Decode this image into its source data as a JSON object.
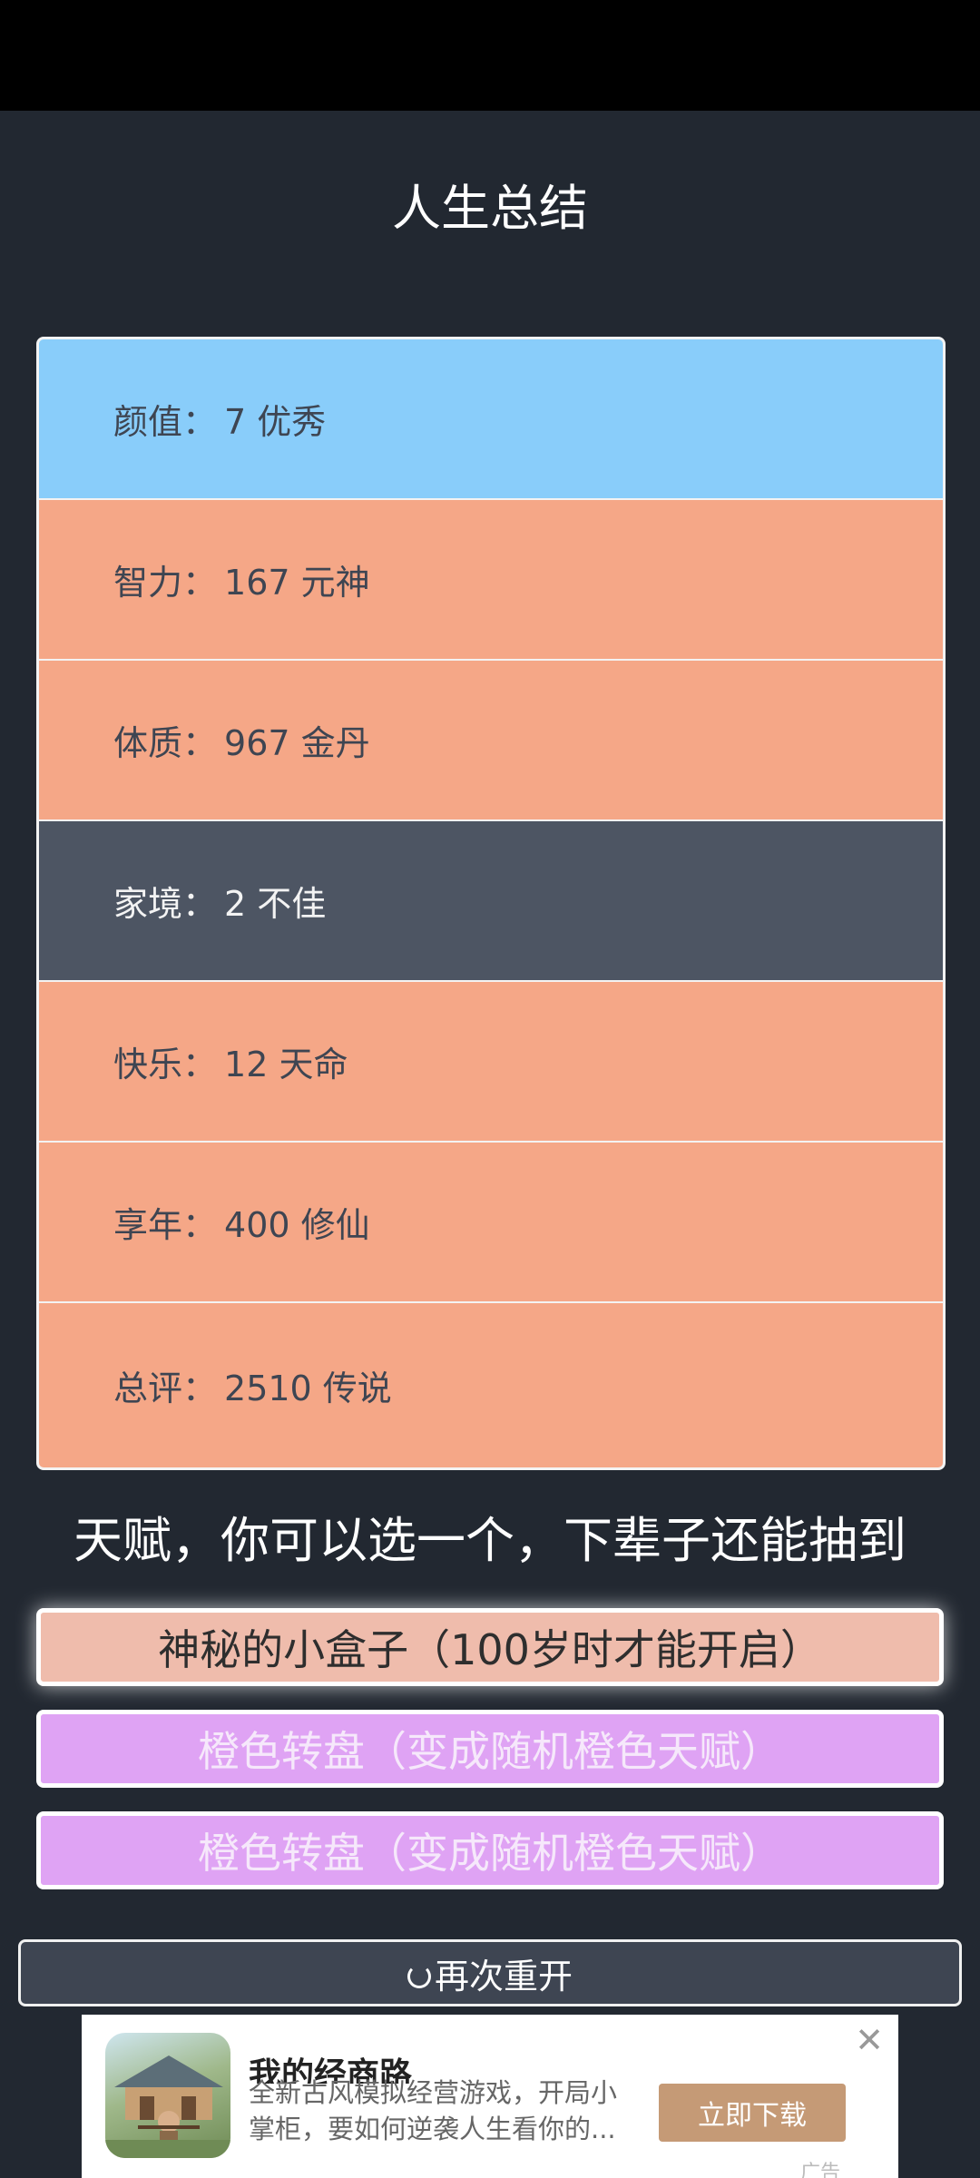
{
  "title": "人生总结",
  "stats": [
    {
      "label": "颜值：",
      "value": "7 优秀",
      "color": "#89cdfa",
      "dark": false
    },
    {
      "label": "智力：",
      "value": "167 元神",
      "color": "#f5a787",
      "dark": false
    },
    {
      "label": "体质：",
      "value": "967 金丹",
      "color": "#f5a787",
      "dark": false
    },
    {
      "label": "家境：",
      "value": "2 不佳",
      "color": "#4d5563",
      "dark": true
    },
    {
      "label": "快乐：",
      "value": "12 天命",
      "color": "#f5a787",
      "dark": false
    },
    {
      "label": "享年：",
      "value": "400 修仙",
      "color": "#f5a787",
      "dark": false
    },
    {
      "label": "总评：",
      "value": "2510 传说",
      "color": "#f5a787",
      "dark": false
    }
  ],
  "talent_heading": "天赋，你可以选一个，下辈子还能抽到",
  "talents": [
    {
      "label": "神秘的小盒子（100岁时才能开启）",
      "selected": true
    },
    {
      "label": "橙色转盘（变成随机橙色天赋）",
      "selected": false
    },
    {
      "label": "橙色转盘（变成随机橙色天赋）",
      "selected": false
    }
  ],
  "restart_label": "再次重开",
  "ad": {
    "title": "我的经商路",
    "description": "全新古风模拟经营游戏，开局小掌柜，要如何逆袭人生看你的...",
    "cta_label": "立即下载",
    "label": "广告",
    "close_icon": "close-icon"
  }
}
